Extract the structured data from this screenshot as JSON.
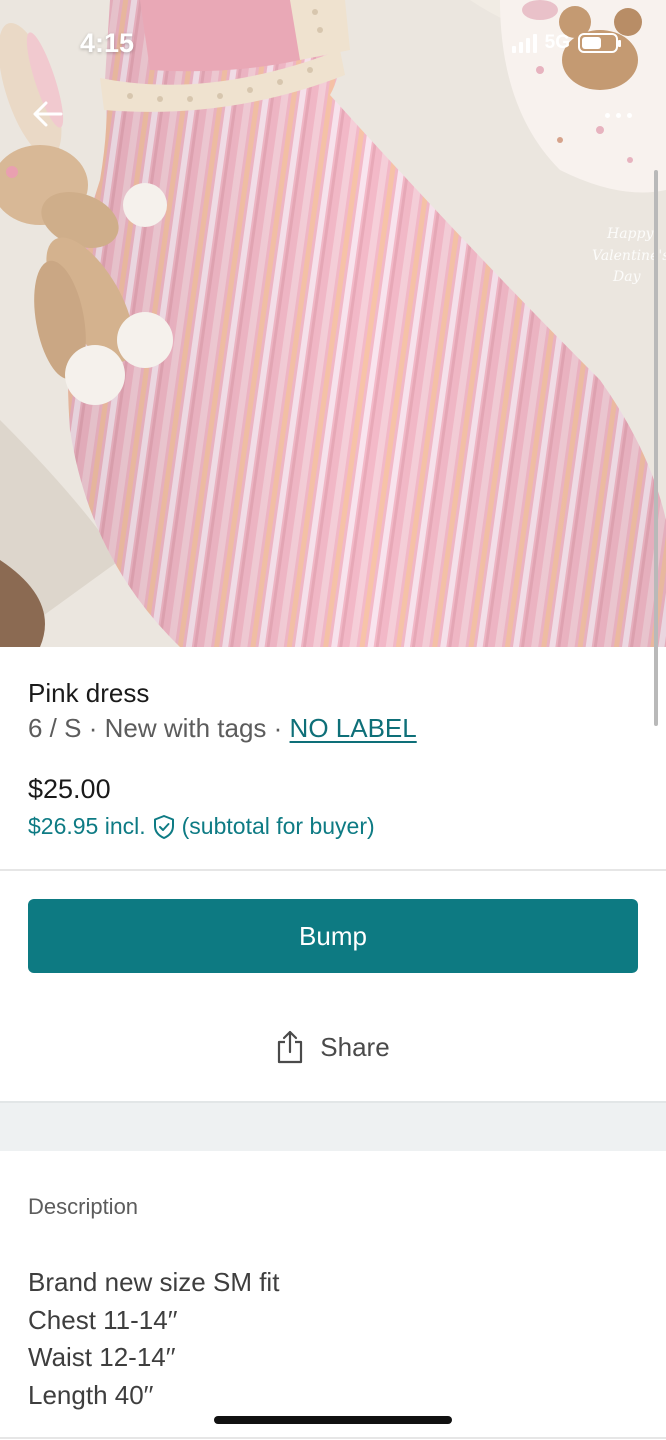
{
  "status_bar": {
    "time": "4:15",
    "network": "5G"
  },
  "listing": {
    "title": "Pink dress",
    "size": "6 / S",
    "sep1": " · ",
    "condition": "New with tags",
    "sep2": " · ",
    "brand": "NO LABEL",
    "price": "$25.00",
    "buyer_price": "$26.95 incl.",
    "buyer_note": "(subtotal for buyer)"
  },
  "actions": {
    "bump_label": "Bump",
    "share_label": "Share"
  },
  "description": {
    "heading": "Description",
    "lines": [
      "Brand new size SM fit",
      "Chest 11-14′′",
      "Waist 12-14′′",
      "Length 40′′"
    ]
  },
  "photo": {
    "overlay_text": [
      "Happy",
      "Valentine's",
      "Day"
    ]
  },
  "icons": {
    "back": "arrow-left-icon",
    "more": "more-dots-icon",
    "protection": "shield-check-icon",
    "share": "share-icon"
  },
  "colors": {
    "accent": "#0d7a82",
    "link": "#0e6f78",
    "dress_pink": "#f1b6c3"
  }
}
